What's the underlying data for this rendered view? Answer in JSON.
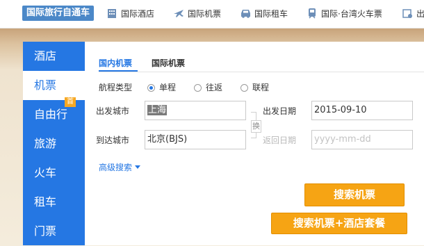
{
  "topbar": {
    "brand": "国际旅行自通车",
    "nav": [
      {
        "label": "国际酒店",
        "icon": "building-icon"
      },
      {
        "label": "国际机票",
        "icon": "plane-icon"
      },
      {
        "label": "国际租车",
        "icon": "car-icon"
      },
      {
        "label": "国际·台湾火车票",
        "icon": "train-icon"
      },
      {
        "label": "出",
        "icon": "ticket-icon"
      }
    ]
  },
  "sidebar": {
    "items": [
      {
        "label": "酒店"
      },
      {
        "label": "机票"
      },
      {
        "label": "自由行",
        "badge": "首"
      },
      {
        "label": "旅游"
      },
      {
        "label": "火车"
      },
      {
        "label": "租车"
      },
      {
        "label": "门票"
      }
    ],
    "active_index": 1
  },
  "search": {
    "tabs": [
      {
        "label": "国内机票"
      },
      {
        "label": "国际机票"
      }
    ],
    "trip_type": {
      "label": "航程类型",
      "options": [
        "单程",
        "往返",
        "联程"
      ],
      "selected": "单程"
    },
    "from_city": {
      "label": "出发城市",
      "value": "上海"
    },
    "to_city": {
      "label": "到达城市",
      "value": "北京(BJS)"
    },
    "depart_date": {
      "label": "出发日期",
      "value": "2015-09-10"
    },
    "return_date": {
      "label": "返回日期",
      "placeholder": "yyyy-mm-dd"
    },
    "swap_label": "换",
    "advanced": "高级搜索",
    "search_button": "搜索机票",
    "package_button": "搜索机票+酒店套餐"
  },
  "colors": {
    "accent": "#2577e3",
    "button": "#f6a414",
    "brand_bg": "#4b88c8"
  }
}
